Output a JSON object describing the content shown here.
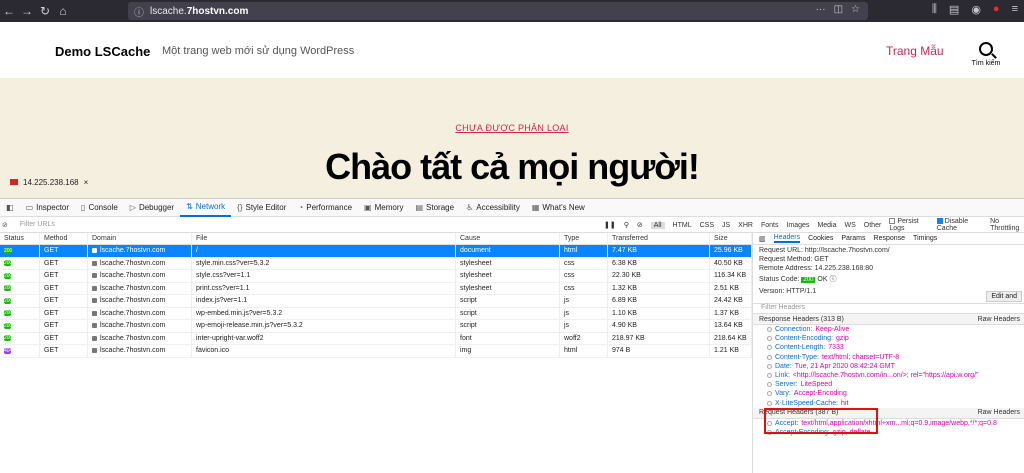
{
  "browser": {
    "url_prefix": "lscache.",
    "url_domain": "7hostvn.com"
  },
  "site": {
    "title": "Demo LSCache",
    "tagline": "Một trang web mới sử dụng WordPress",
    "menu_item": "Trang Mẫu",
    "search_label": "Tìm kiếm",
    "category": "CHƯA ĐƯỢC PHÂN LOẠI",
    "post_title": "Chào tất cả mọi người!",
    "ip_badge": "14.225.238.168"
  },
  "devtools": {
    "tabs": [
      "Inspector",
      "Console",
      "Debugger",
      "Network",
      "Style Editor",
      "Performance",
      "Memory",
      "Storage",
      "Accessibility",
      "What's New"
    ],
    "active_tab": "Network",
    "filter_placeholder": "Filter URLs",
    "type_filters": [
      "All",
      "HTML",
      "CSS",
      "JS",
      "XHR",
      "Fonts",
      "Images",
      "Media",
      "WS",
      "Other"
    ],
    "persist_logs": "Persist Logs",
    "disable_cache": "Disable Cache",
    "throttling": "No Throttling",
    "columns": {
      "status": "Status",
      "method": "Method",
      "domain": "Domain",
      "file": "File",
      "cause": "Cause",
      "type": "Type",
      "transferred": "Transferred",
      "size": "Size"
    },
    "rows": [
      {
        "status": "200",
        "method": "GET",
        "domain": "lscache.7hostvn.com",
        "file": "/",
        "cause": "document",
        "type": "html",
        "transferred": "7.47 KB",
        "size": "25.96 KB"
      },
      {
        "status": "200",
        "method": "GET",
        "domain": "lscache.7hostvn.com",
        "file": "style.min.css?ver=5.3.2",
        "cause": "stylesheet",
        "type": "css",
        "transferred": "6.38 KB",
        "size": "40.50 KB"
      },
      {
        "status": "200",
        "method": "GET",
        "domain": "lscache.7hostvn.com",
        "file": "style.css?ver=1.1",
        "cause": "stylesheet",
        "type": "css",
        "transferred": "22.30 KB",
        "size": "116.34 KB"
      },
      {
        "status": "200",
        "method": "GET",
        "domain": "lscache.7hostvn.com",
        "file": "print.css?ver=1.1",
        "cause": "stylesheet",
        "type": "css",
        "transferred": "1.32 KB",
        "size": "2.51 KB"
      },
      {
        "status": "200",
        "method": "GET",
        "domain": "lscache.7hostvn.com",
        "file": "index.js?ver=1.1",
        "cause": "script",
        "type": "js",
        "transferred": "6.89 KB",
        "size": "24.42 KB"
      },
      {
        "status": "200",
        "method": "GET",
        "domain": "lscache.7hostvn.com",
        "file": "wp-embed.min.js?ver=5.3.2",
        "cause": "script",
        "type": "js",
        "transferred": "1.10 KB",
        "size": "1.37 KB"
      },
      {
        "status": "200",
        "method": "GET",
        "domain": "lscache.7hostvn.com",
        "file": "wp-emoji-release.min.js?ver=5.3.2",
        "cause": "script",
        "type": "js",
        "transferred": "4.90 KB",
        "size": "13.64 KB"
      },
      {
        "status": "200",
        "method": "GET",
        "domain": "lscache.7hostvn.com",
        "file": "inter-upright-var.woff2",
        "cause": "font",
        "type": "woff2",
        "transferred": "218.97 KB",
        "size": "218.64 KB"
      },
      {
        "status": "404",
        "method": "GET",
        "domain": "lscache.7hostvn.com",
        "file": "favicon.ico",
        "cause": "img",
        "type": "html",
        "transferred": "974 B",
        "size": "1.21 KB"
      }
    ],
    "side_tabs": [
      "Headers",
      "Cookies",
      "Params",
      "Response",
      "Timings"
    ],
    "request_url": "Request URL: http://lscache.7hostvn.com/",
    "request_method": "Request Method: GET",
    "remote_address": "Remote Address: 14.225.238.168:80",
    "status_code_label": "Status Code:",
    "status_code": "200",
    "status_ok": "OK",
    "version": "Version: HTTP/1.1",
    "edit_button": "Edit and",
    "filter_headers": "Filter Headers",
    "response_headers_title": "Response Headers (313 B)",
    "raw_headers": "Raw Headers",
    "response_headers": [
      {
        "k": "Connection:",
        "v": "Keep-Alive"
      },
      {
        "k": "Content-Encoding:",
        "v": "gzip"
      },
      {
        "k": "Content-Length:",
        "v": "7333"
      },
      {
        "k": "Content-Type:",
        "v": "text/html; charset=UTF-8"
      },
      {
        "k": "Date:",
        "v": "Tue, 21 Apr 2020 08:42:24 GMT"
      },
      {
        "k": "Link:",
        "v": "<http://lscache.7hostvn.com/in...on/>; rel=\"https://api.w.org/\""
      },
      {
        "k": "Server:",
        "v": "LiteSpeed"
      },
      {
        "k": "Vary:",
        "v": "Accept-Encoding"
      },
      {
        "k": "X-LiteSpeed-Cache:",
        "v": "hit"
      }
    ],
    "request_headers_title": "Request Headers (387 B)",
    "request_headers": [
      {
        "k": "Accept:",
        "v": "text/html,application/xhtml+xm...ml;q=0.9,image/webp,*/*;q=0.8"
      },
      {
        "k": "Accept-Encoding:",
        "v": "gzip, deflate"
      }
    ]
  }
}
